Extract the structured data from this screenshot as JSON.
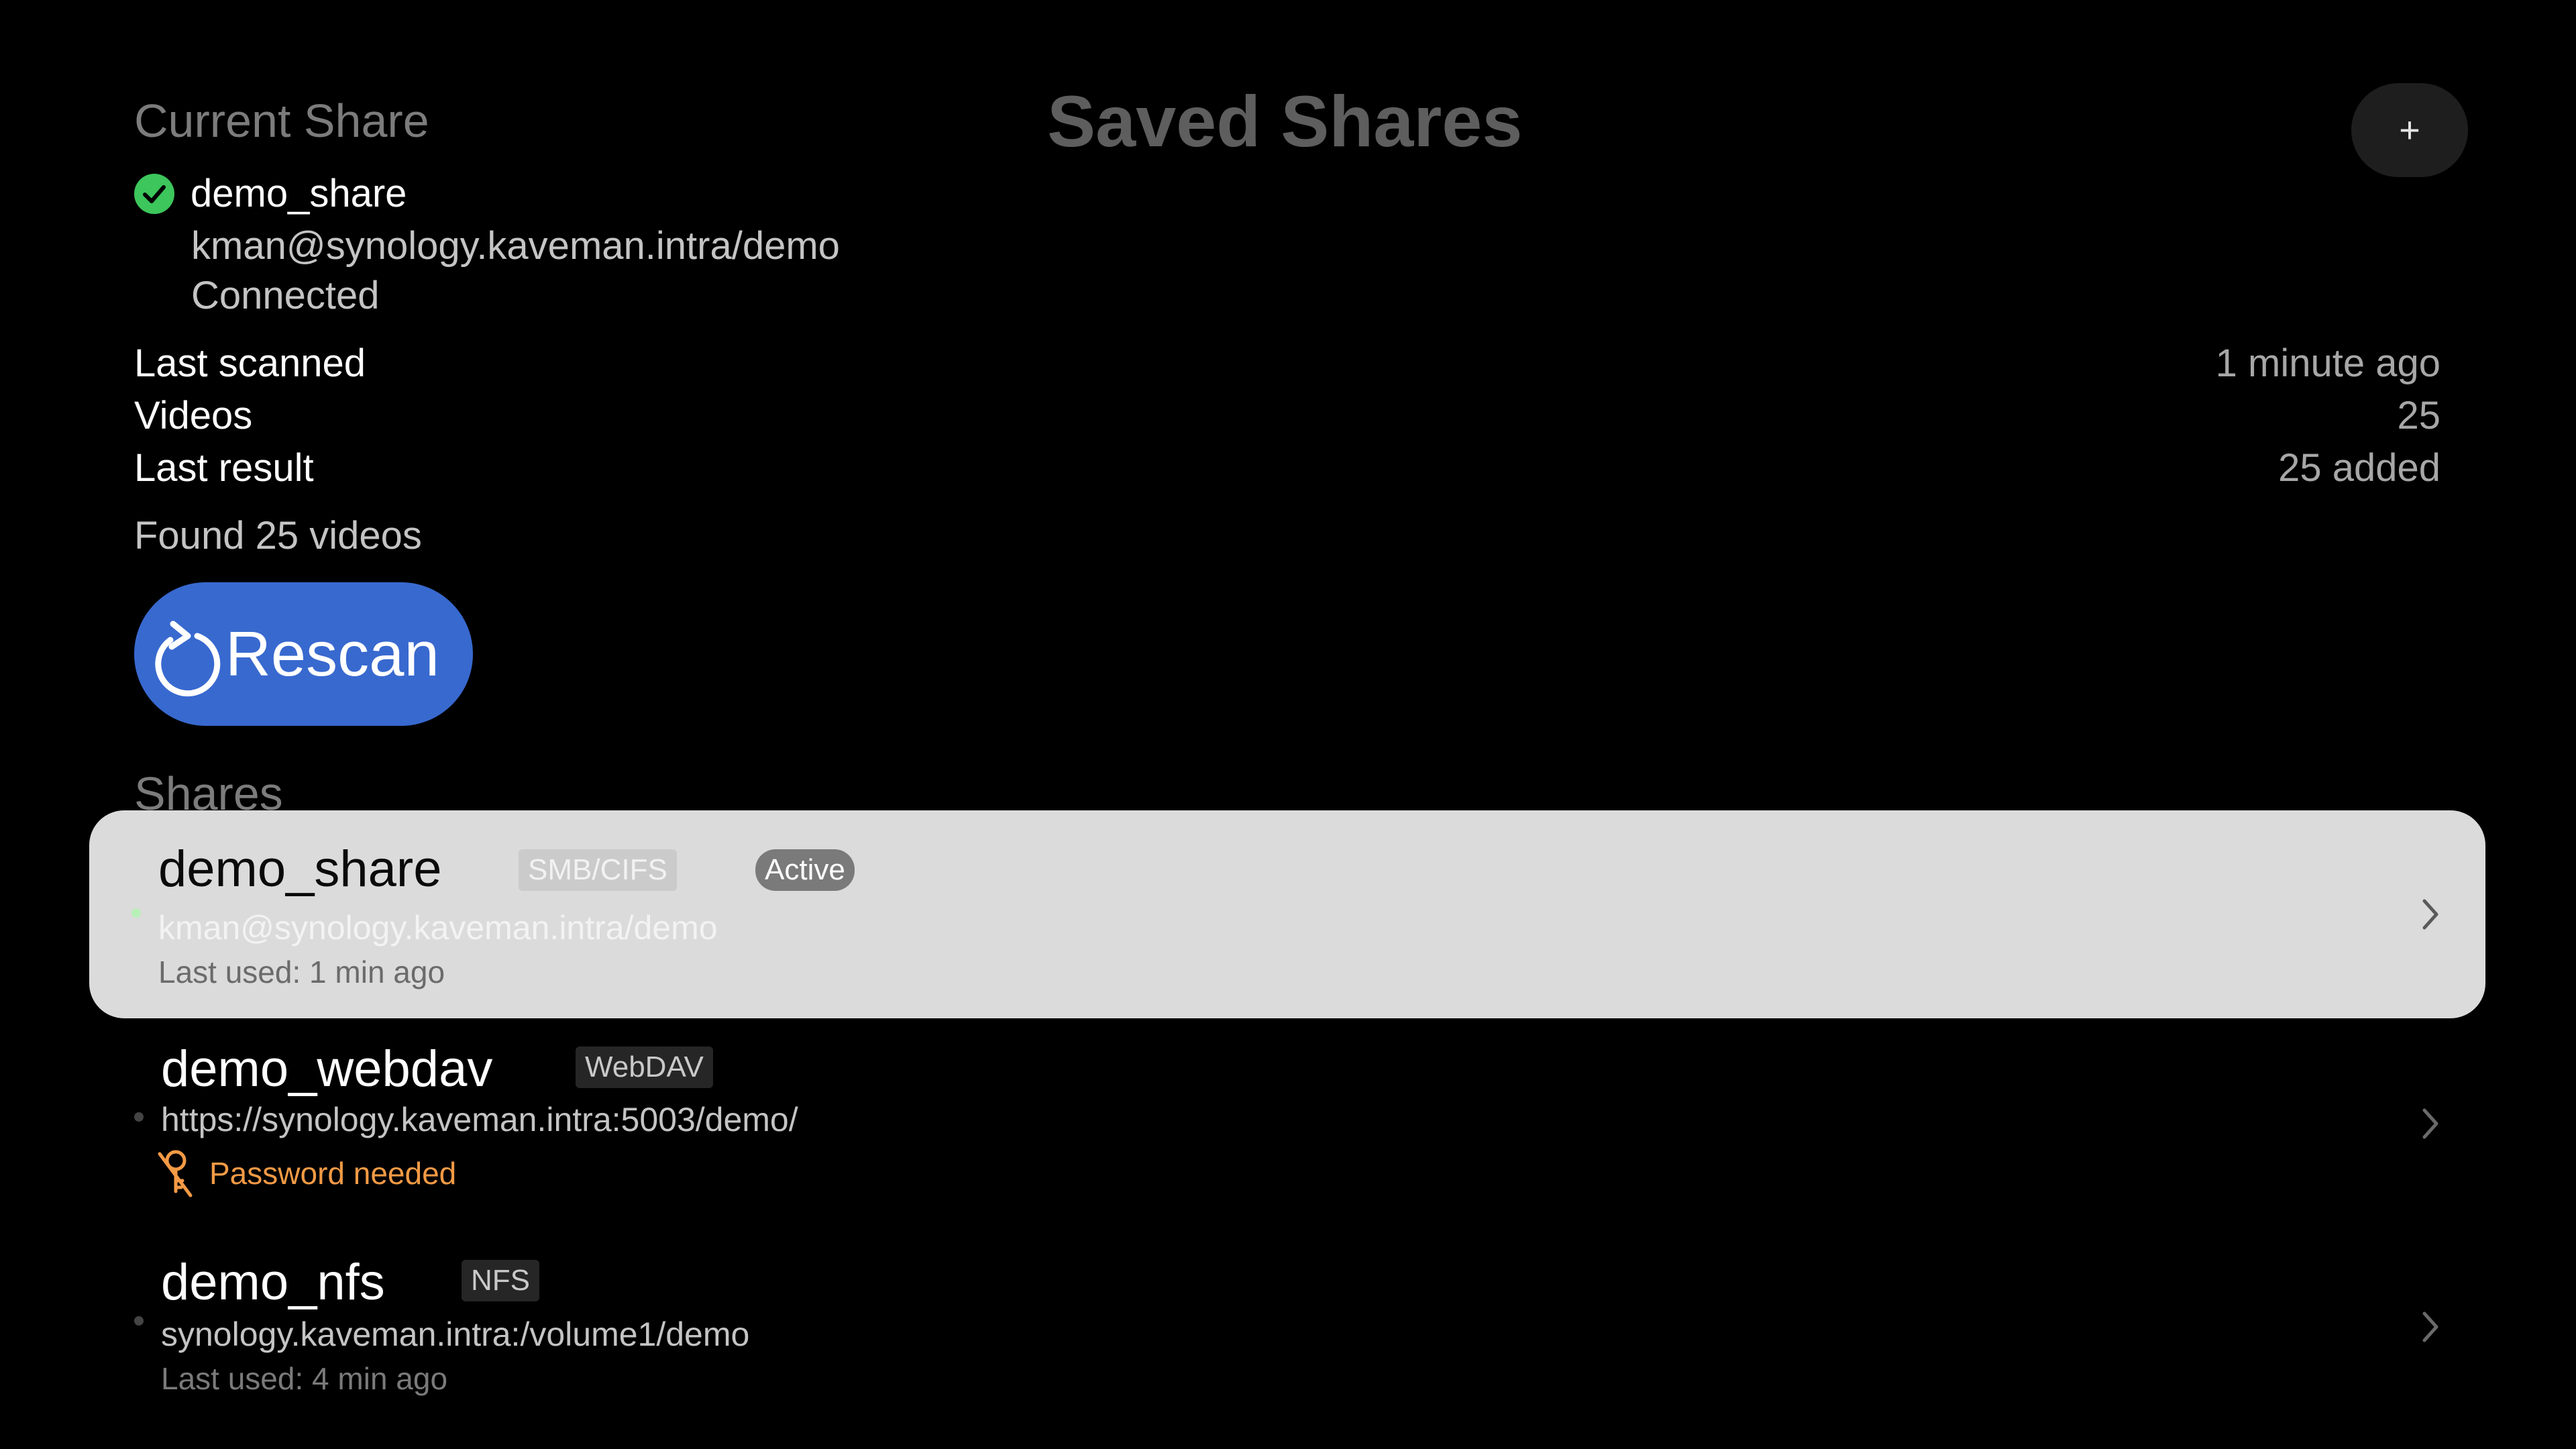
{
  "current_share": {
    "section_title": "Current Share",
    "name": "demo_share",
    "path": "kman@synology.kaveman.intra/demo",
    "status": "Connected",
    "status_icon": "checkmark-circle-icon",
    "status_color": "#3cc65b",
    "info": [
      {
        "label": "Last scanned",
        "value": "1 minute ago"
      },
      {
        "label": "Videos",
        "value": "25"
      },
      {
        "label": "Last result",
        "value": "25 added"
      }
    ],
    "found_text": "Found 25 videos",
    "rescan_label": "Rescan",
    "rescan_icon": "refresh-icon",
    "rescan_color": "#3869cf"
  },
  "header": {
    "title": "Saved Shares",
    "add_label": "+"
  },
  "shares": {
    "section_title": "Shares",
    "items": [
      {
        "name": "demo_share",
        "protocol": "SMB/CIFS",
        "badge": "Active",
        "path": "kman@synology.kaveman.intra/demo",
        "sub": "Last used: 1 min ago",
        "focused": true
      },
      {
        "name": "demo_webdav",
        "protocol": "WebDAV",
        "path": "https://synology.kaveman.intra:5003/demo/",
        "sub": "Password needed",
        "sub_icon": "key-slash-icon",
        "sub_color": "#f39a45"
      },
      {
        "name": "demo_nfs",
        "protocol": "NFS",
        "path": "synology.kaveman.intra:/volume1/demo",
        "sub": "Last used: 4 min ago"
      }
    ]
  }
}
